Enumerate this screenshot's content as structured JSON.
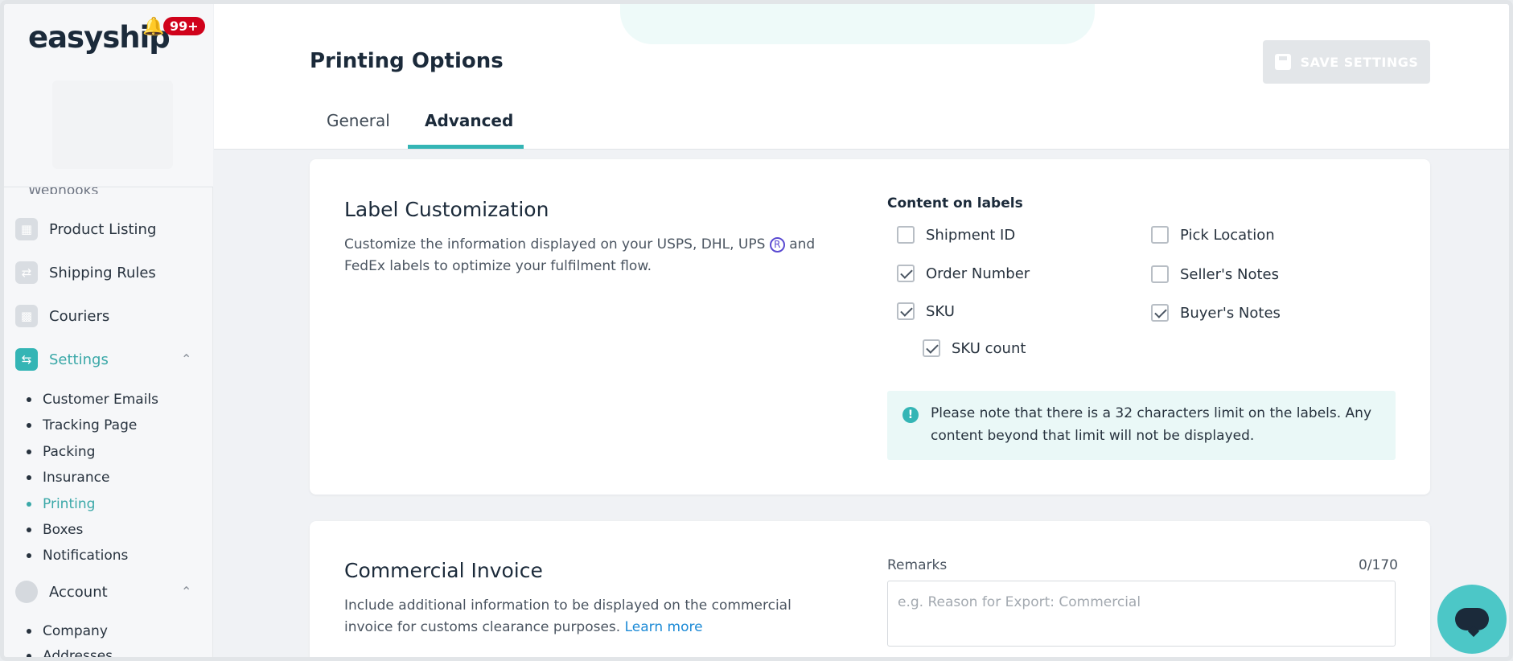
{
  "brand": {
    "logo_text": "easyship",
    "notification_count": "99+"
  },
  "sidebar": {
    "peek_item": "Webhooks",
    "items": [
      {
        "label": "Product Listing",
        "icon": "product-listing-icon"
      },
      {
        "label": "Shipping Rules",
        "icon": "shipping-rules-icon"
      },
      {
        "label": "Couriers",
        "icon": "couriers-icon"
      },
      {
        "label": "Settings",
        "icon": "settings-icon",
        "active": true
      }
    ],
    "settings_subitems": [
      "Customer Emails",
      "Tracking Page",
      "Packing",
      "Insurance",
      "Printing",
      "Boxes",
      "Notifications"
    ],
    "account_label": "Account",
    "account_subitems": [
      "Company",
      "Addresses"
    ]
  },
  "header": {
    "title": "Printing Options",
    "save_label": "SAVE SETTINGS",
    "tabs": [
      {
        "label": "General"
      },
      {
        "label": "Advanced",
        "active": true
      }
    ]
  },
  "label_customization": {
    "title": "Label Customization",
    "desc_before": "Customize the information displayed on your USPS, DHL, UPS",
    "reg_mark": "R",
    "desc_after": "and FedEx labels to optimize your fulfilment flow.",
    "content_heading": "Content on labels",
    "options": [
      {
        "label": "Shipment ID",
        "checked": false
      },
      {
        "label": "Order Number",
        "checked": true
      },
      {
        "label": "SKU",
        "checked": true
      },
      {
        "label": "SKU count",
        "checked": true
      },
      {
        "label": "Pick Location",
        "checked": false
      },
      {
        "label": "Seller's Notes",
        "checked": false
      },
      {
        "label": "Buyer's Notes",
        "checked": true
      }
    ],
    "note_icon": "!",
    "note": "Please note that there is a 32 characters limit on the labels. Any content beyond that limit will not be displayed."
  },
  "commercial_invoice": {
    "title": "Commercial Invoice",
    "desc": "Include additional information to be displayed on the commercial invoice for customs clearance purposes.",
    "learn_more": "Learn more",
    "remarks_label": "Remarks",
    "remarks_count": "0/170",
    "remarks_placeholder": "e.g. Reason for Export: Commercial",
    "remarks_value": ""
  },
  "colors": {
    "accent": "#34b5b5",
    "brand_dark": "#1b2a3a",
    "badge": "#d0021b",
    "link": "#1c8ad6"
  }
}
